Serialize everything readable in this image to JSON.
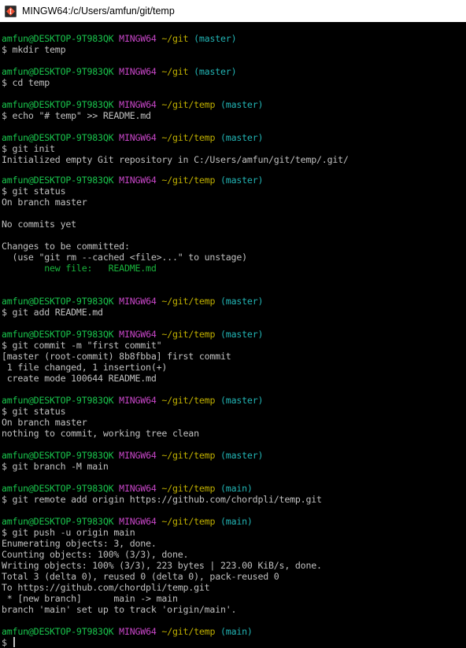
{
  "window": {
    "title": "MINGW64:/c/Users/amfun/git/temp"
  },
  "colors": {
    "background": "#000000",
    "user": "#19c44c",
    "mingw": "#c846c8",
    "path": "#c0b000",
    "branch": "#22b4b4",
    "text": "#c0c0c0",
    "new_file": "#19b43c"
  },
  "prompts": [
    {
      "user": "amfun@DESKTOP-9T983QK",
      "env": "MINGW64",
      "path": "~/git",
      "branch": "(master)",
      "command": "$ mkdir temp"
    },
    {
      "user": "amfun@DESKTOP-9T983QK",
      "env": "MINGW64",
      "path": "~/git",
      "branch": "(master)",
      "command": "$ cd temp"
    },
    {
      "user": "amfun@DESKTOP-9T983QK",
      "env": "MINGW64",
      "path": "~/git/temp",
      "branch": "(master)",
      "command": "$ echo \"# temp\" >> README.md"
    },
    {
      "user": "amfun@DESKTOP-9T983QK",
      "env": "MINGW64",
      "path": "~/git/temp",
      "branch": "(master)",
      "command": "$ git init"
    },
    {
      "user": "amfun@DESKTOP-9T983QK",
      "env": "MINGW64",
      "path": "~/git/temp",
      "branch": "(master)",
      "command": "$ git status"
    },
    {
      "user": "amfun@DESKTOP-9T983QK",
      "env": "MINGW64",
      "path": "~/git/temp",
      "branch": "(master)",
      "command": "$ git add README.md"
    },
    {
      "user": "amfun@DESKTOP-9T983QK",
      "env": "MINGW64",
      "path": "~/git/temp",
      "branch": "(master)",
      "command": "$ git commit -m \"first commit\""
    },
    {
      "user": "amfun@DESKTOP-9T983QK",
      "env": "MINGW64",
      "path": "~/git/temp",
      "branch": "(master)",
      "command": "$ git status"
    },
    {
      "user": "amfun@DESKTOP-9T983QK",
      "env": "MINGW64",
      "path": "~/git/temp",
      "branch": "(master)",
      "command": "$ git branch -M main"
    },
    {
      "user": "amfun@DESKTOP-9T983QK",
      "env": "MINGW64",
      "path": "~/git/temp",
      "branch": "(main)",
      "command": "$ git remote add origin https://github.com/chordpli/temp.git"
    },
    {
      "user": "amfun@DESKTOP-9T983QK",
      "env": "MINGW64",
      "path": "~/git/temp",
      "branch": "(main)",
      "command": "$ git push -u origin main"
    },
    {
      "user": "amfun@DESKTOP-9T983QK",
      "env": "MINGW64",
      "path": "~/git/temp",
      "branch": "(main)",
      "command": "$ "
    }
  ],
  "outputs": {
    "init": "Initialized empty Git repository in C:/Users/amfun/git/temp/.git/",
    "status1": [
      "On branch master",
      "",
      "No commits yet",
      "",
      "Changes to be committed:",
      "  (use \"git rm --cached <file>...\" to unstage)"
    ],
    "new_file": "        new file:   README.md",
    "commit": [
      "[master (root-commit) 8b8fbba] first commit",
      " 1 file changed, 1 insertion(+)",
      " create mode 100644 README.md"
    ],
    "status2": [
      "On branch master",
      "nothing to commit, working tree clean"
    ],
    "push": [
      "Enumerating objects: 3, done.",
      "Counting objects: 100% (3/3), done.",
      "Writing objects: 100% (3/3), 223 bytes | 223.00 KiB/s, done.",
      "Total 3 (delta 0), reused 0 (delta 0), pack-reused 0",
      "To https://github.com/chordpli/temp.git",
      " * [new branch]      main -> main",
      "branch 'main' set up to track 'origin/main'."
    ]
  }
}
